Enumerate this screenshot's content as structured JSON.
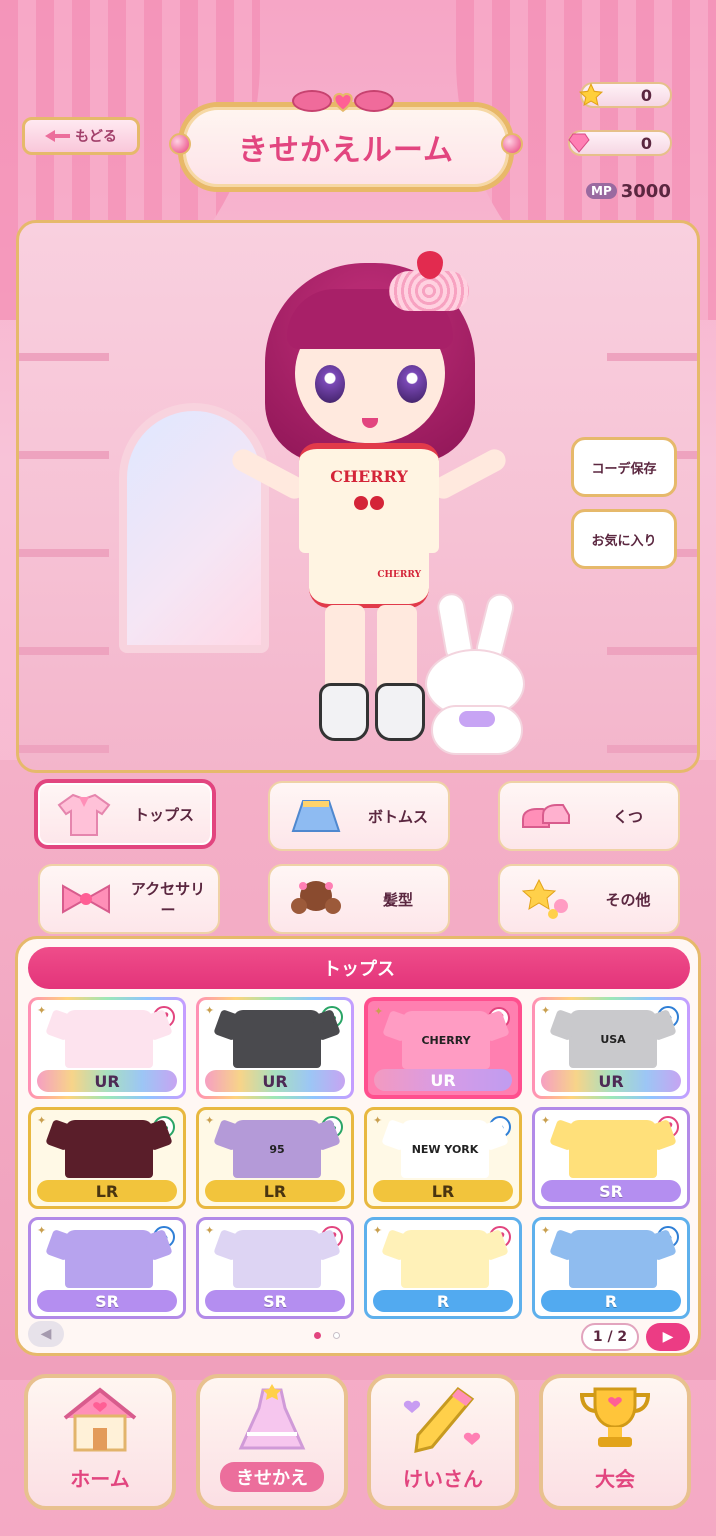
{
  "header": {
    "back_label": "もどる",
    "title": "きせかえルーム"
  },
  "currency": {
    "stars": "0",
    "gems": "0",
    "mp_label": "MP",
    "mp_value": "3000"
  },
  "stage": {
    "shirt_logo": "CHERRY",
    "shorts_logo": "CHERRY",
    "save_button": "コーデ保存",
    "favorite_button": "お気に入り"
  },
  "categories": [
    {
      "label": "トップス",
      "icon": "top-icon",
      "active": true
    },
    {
      "label": "ボトムス",
      "icon": "skirt-icon",
      "active": false
    },
    {
      "label": "くつ",
      "icon": "shoes-icon",
      "active": false
    },
    {
      "label": "アクセサリー",
      "icon": "bow-icon",
      "active": false
    },
    {
      "label": "髪型",
      "icon": "hair-icon",
      "active": false
    },
    {
      "label": "その他",
      "icon": "star-icon",
      "active": false
    }
  ],
  "panel": {
    "title": "トップス",
    "page_indicator": "1 / 2",
    "items": [
      {
        "rarity": "UR",
        "tag": "heart",
        "print": "",
        "color": "#fde3ee"
      },
      {
        "rarity": "UR",
        "tag": "clover",
        "print": "",
        "color": "#4a4a4e"
      },
      {
        "rarity": "UR",
        "tag": "heart",
        "print": "CHERRY",
        "color": "#ff9cc3",
        "selected": true
      },
      {
        "rarity": "UR",
        "tag": "spade",
        "print": "USA",
        "color": "#c9c9cc"
      },
      {
        "rarity": "LR",
        "tag": "clover",
        "print": "",
        "color": "#5a1e2a"
      },
      {
        "rarity": "LR",
        "tag": "clover",
        "print": "95",
        "color": "#b49ad8"
      },
      {
        "rarity": "LR",
        "tag": "spade",
        "print": "NEW YORK",
        "color": "#ffffff"
      },
      {
        "rarity": "SR",
        "tag": "heart",
        "print": "",
        "color": "#ffe07a"
      },
      {
        "rarity": "SR",
        "tag": "spade",
        "print": "",
        "color": "#b7a3ee"
      },
      {
        "rarity": "SR",
        "tag": "heart",
        "print": "",
        "color": "#ddd4f3"
      },
      {
        "rarity": "R",
        "tag": "heart",
        "print": "",
        "color": "#fff1b8"
      },
      {
        "rarity": "R",
        "tag": "spade",
        "print": "",
        "color": "#8fbcef"
      }
    ]
  },
  "nav": [
    {
      "label": "ホーム",
      "icon": "house-icon"
    },
    {
      "label": "きせかえ",
      "icon": "dress-icon",
      "active": true
    },
    {
      "label": "けいさん",
      "icon": "pencil-icon"
    },
    {
      "label": "大会",
      "icon": "trophy-icon"
    }
  ]
}
